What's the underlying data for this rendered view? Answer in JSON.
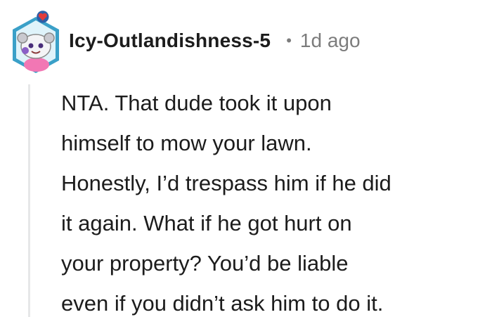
{
  "comment": {
    "author": "Icy-Outlandishness-5",
    "separator": "•",
    "timestamp": "1d ago",
    "avatar_icon": "snoo-avatar-icon",
    "badge_icon": "heart-badge-icon",
    "body_lines": [
      "NTA. That dude took it upon",
      "himself to mow your lawn.",
      "Honestly, I’d trespass him if he did",
      "it again. What if he got hurt on",
      "your property? You’d be liable",
      "even if you didn’t ask him to do it."
    ]
  },
  "colors": {
    "username": "#1c1c1c",
    "meta": "#7c7c7c",
    "thread_line": "#e6e7e8",
    "avatar_hex": "#3aa0c8",
    "badge_heart": "#e23b3b"
  }
}
